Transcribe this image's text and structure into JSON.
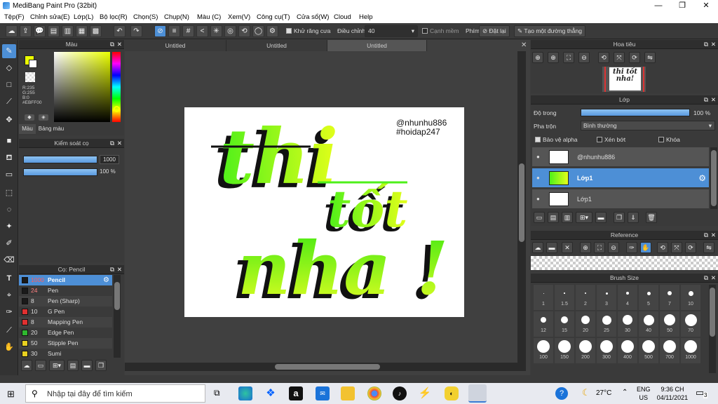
{
  "window": {
    "title": "MediBang Paint Pro (32bit)",
    "minimize": "—",
    "maximize": "❐",
    "close": "✕"
  },
  "menu": [
    "Tệp(F)",
    "Chỉnh sửa(E)",
    "Lớp(L)",
    "Bộ lọc(R)",
    "Chọn(S)",
    "Chụp(N)",
    "Màu (C)",
    "Xem(V)",
    "Công cụ(T)",
    "Cửa sổ(W)",
    "Cloud",
    "Help"
  ],
  "toolbar": {
    "antialias_label": "Khử răng cưa",
    "adjust_label": "Điều chỉnh",
    "adjust_value": "40",
    "snap_label": "Cạnh mềm",
    "pen_label": "Phím",
    "reset_label": "Đặt lại",
    "straight_label": "Tạo một đường thẳng"
  },
  "color_panel": {
    "title": "Màu",
    "rgb_r": "R:235",
    "rgb_g": "G:255",
    "rgb_b": "B:0",
    "hex": "#EBFF00",
    "tab_color": "Màu",
    "tab_palette": "Bảng màu",
    "primary_color": "#EBFF00",
    "secondary_color": "#FFFFFF"
  },
  "brush_control": {
    "title": "Kiểm soát cọ",
    "size": "1000",
    "opacity": "100 %",
    "size_fraction": 1.0,
    "opacity_fraction": 1.0
  },
  "brush_list": {
    "title": "Cọ: Pencil",
    "items": [
      {
        "size": "1000",
        "name": "Pencil",
        "color": "#1a1a1a",
        "selected": true
      },
      {
        "size": "24",
        "name": "Pen",
        "color": "#1a1a1a"
      },
      {
        "size": "8",
        "name": "Pen (Sharp)",
        "color": "#1a1a1a"
      },
      {
        "size": "10",
        "name": "G Pen",
        "color": "#e03030"
      },
      {
        "size": "8",
        "name": "Mapping Pen",
        "color": "#e03030"
      },
      {
        "size": "20",
        "name": "Edge Pen",
        "color": "#2fb82f"
      },
      {
        "size": "50",
        "name": "Stipple Pen",
        "color": "#e8d020"
      },
      {
        "size": "30",
        "name": "Sumi",
        "color": "#e8d020"
      }
    ]
  },
  "tabs": [
    "Untitled",
    "Untitled",
    "Untitled"
  ],
  "artwork": {
    "line1": "thi",
    "line2": "tốt",
    "line3": "nha !",
    "tag1": "@nhunhu886",
    "tag2": "#hoidap247"
  },
  "navigator": {
    "title": "Hoa tiêu",
    "preview_text": "thi tốt nha!"
  },
  "layer_panel": {
    "title": "Lớp",
    "opacity_label": "Độ trong",
    "opacity_value": "100 %",
    "opacity_fraction": 1.0,
    "blend_label": "Pha trộn",
    "blend_value": "Bình thường",
    "protect_alpha": "Bảo vệ alpha",
    "clipping": "Xén bớt",
    "lock": "Khóa",
    "layers": [
      {
        "name": "@nhunhu886",
        "selected": false
      },
      {
        "name": "Lớp1",
        "selected": true
      },
      {
        "name": "Lớp1",
        "selected": false
      }
    ]
  },
  "reference_panel": {
    "title": "Reference"
  },
  "brush_size_panel": {
    "title": "Brush Size",
    "sizes": [
      "1",
      "1.5",
      "2",
      "3",
      "4",
      "5",
      "7",
      "10",
      "12",
      "15",
      "20",
      "25",
      "30",
      "40",
      "50",
      "70",
      "100",
      "150",
      "200",
      "300",
      "400",
      "500",
      "700",
      "1000"
    ]
  },
  "taskbar": {
    "search_placeholder": "Nhập tại đây để tìm kiếm",
    "weather": "27°C",
    "lang": "ENG",
    "region": "US",
    "time": "9:36 CH",
    "date": "04/11/2021",
    "notifications": "3"
  }
}
